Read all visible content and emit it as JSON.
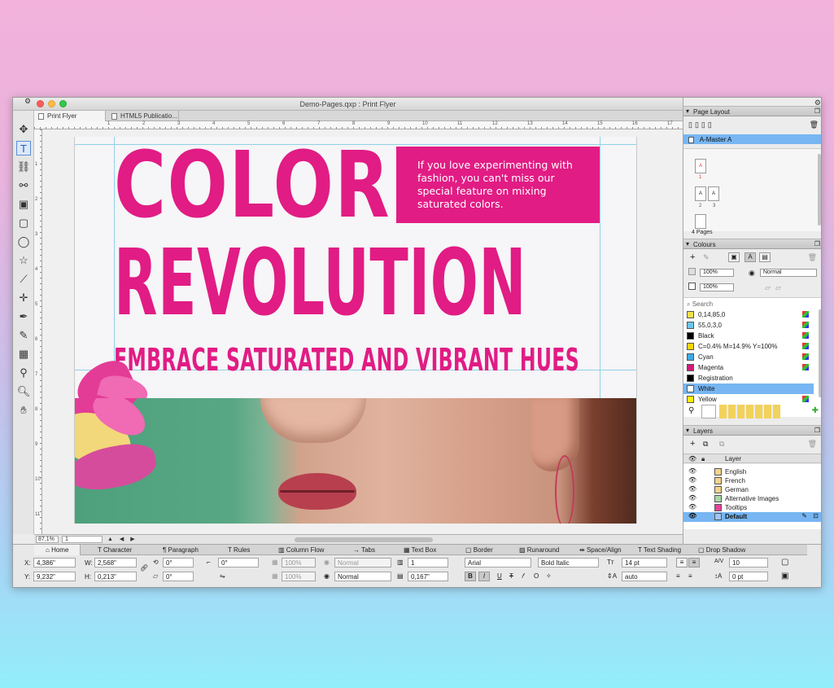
{
  "window": {
    "title": "Demo-Pages.qxp : Print Flyer"
  },
  "tabs": [
    {
      "label": "Print Flyer"
    },
    {
      "label": "HTML5 Publicatio..."
    }
  ],
  "ruler": {
    "h": [
      "0",
      "1",
      "2",
      "3",
      "4",
      "5",
      "6",
      "7",
      "8",
      "9",
      "10",
      "11",
      "12",
      "13",
      "14",
      "15",
      "16",
      "17",
      "18"
    ],
    "v": [
      "1",
      "2",
      "3",
      "4",
      "5",
      "6",
      "7",
      "8",
      "9",
      "10",
      "11",
      "12"
    ]
  },
  "document": {
    "headline1": "COLOR",
    "headline2": "REVOLUTION",
    "subhead": "EMBRACE SATURATED AND VIBRANT HUES",
    "box_text": "If you love experimenting with fashion, you can't miss our special feature on mixing saturated colors.",
    "accent": "#e11c84"
  },
  "status": {
    "zoom": "87,1%",
    "page": "1",
    "nav": "▲ ◀ ▶"
  },
  "page_layout": {
    "title": "Page Layout",
    "master": "A-Master A",
    "pages_label": "4 Pages",
    "thumbs": [
      "A",
      "A",
      "A"
    ],
    "page_numbers": [
      "1",
      "2",
      "3"
    ]
  },
  "colours": {
    "title": "Colours",
    "tint1": "100%",
    "tint2": "100%",
    "blend": "Normal",
    "search": "Search",
    "items": [
      {
        "name": "0,14,85,0",
        "color": "#f5e04a"
      },
      {
        "name": "55,0,3,0",
        "color": "#6ec6ea"
      },
      {
        "name": "Black",
        "color": "#000000"
      },
      {
        "name": "C=0.4% M=14.9% Y=100%",
        "color": "#f9d600"
      },
      {
        "name": "Cyan",
        "color": "#3fa9e6"
      },
      {
        "name": "Magenta",
        "color": "#d11b79"
      },
      {
        "name": "Registration",
        "color": "#000000"
      },
      {
        "name": "White",
        "color": "#ffffff"
      },
      {
        "name": "Yellow",
        "color": "#fff200"
      }
    ]
  },
  "layers": {
    "title": "Layers",
    "header": "Layer",
    "items": [
      {
        "name": "English",
        "color": "#f4d38a"
      },
      {
        "name": "French",
        "color": "#f4d38a"
      },
      {
        "name": "German",
        "color": "#f4d38a"
      },
      {
        "name": "Alternative Images",
        "color": "#a8d8a8"
      },
      {
        "name": "Tooltips",
        "color": "#e4449c"
      },
      {
        "name": "Default",
        "color": "#9fc6f4"
      }
    ]
  },
  "measure_tabs": [
    "Home",
    "Character",
    "Paragraph",
    "Rules",
    "Column Flow",
    "Tabs",
    "Text Box",
    "Border",
    "Runaround",
    "Space/Align",
    "Text Shading",
    "Drop Shadow"
  ],
  "measure": {
    "x_label": "X:",
    "x": "4,386\"",
    "y_label": "Y:",
    "y": "9,232\"",
    "w_label": "W:",
    "w": "2,568\"",
    "h_label": "H:",
    "h": "0,213\"",
    "angle1": "0°",
    "angle2": "0°",
    "angle3": "0°",
    "opacity1": "100%",
    "opacity2": "100%",
    "blend1": "Normal",
    "blend2": "Normal",
    "cols": "1",
    "gutter": "0,167\"",
    "font": "Arial",
    "style": "Bold Italic",
    "size": "14 pt",
    "leading": "auto",
    "tracking": "10",
    "baseline": "0 pt"
  }
}
